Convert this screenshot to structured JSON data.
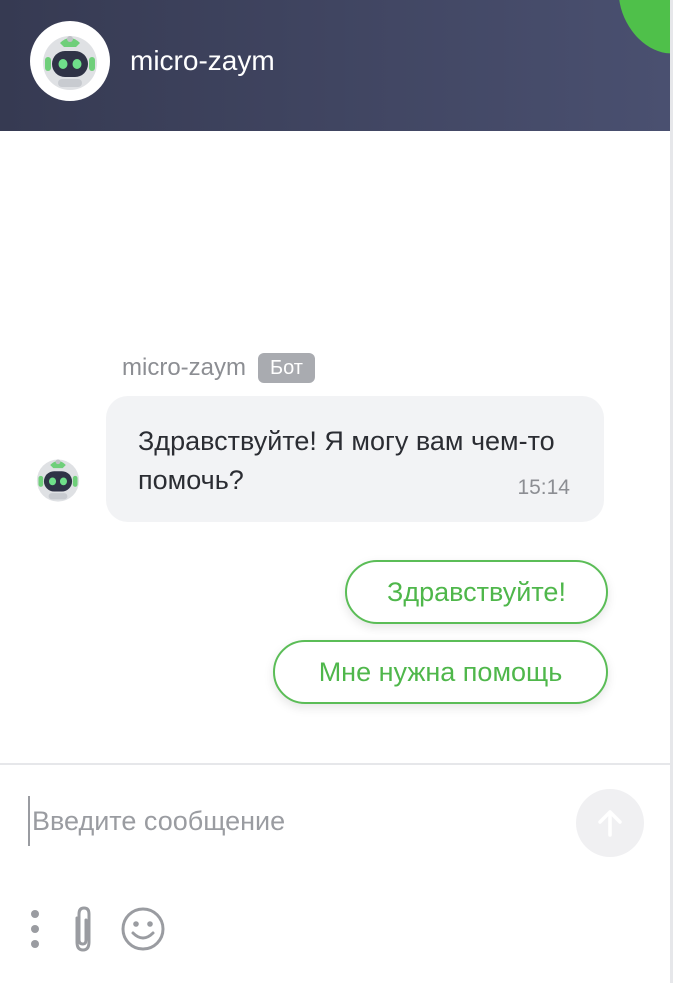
{
  "header": {
    "title": "micro-zaym"
  },
  "message": {
    "sender": "micro-zaym",
    "badge": "Бот",
    "text": "Здравствуйте! Я могу вам чем-то помочь?",
    "time": "15:14"
  },
  "quick_replies": [
    {
      "label": "Здравствуйте!"
    },
    {
      "label": "Мне нужна помощь"
    }
  ],
  "composer": {
    "placeholder": "Введите сообщение",
    "value": ""
  },
  "icons": {
    "avatar": "robot-avatar-icon",
    "send": "arrow-up-icon",
    "more": "vertical-dots-icon",
    "attach": "paperclip-icon",
    "emoji": "smiley-icon"
  },
  "colors": {
    "header_start": "#363a52",
    "header_end": "#4a5070",
    "accent_green": "#4fb74b",
    "bubble_bg": "#f2f3f5",
    "badge_bg": "#a9abb0"
  }
}
